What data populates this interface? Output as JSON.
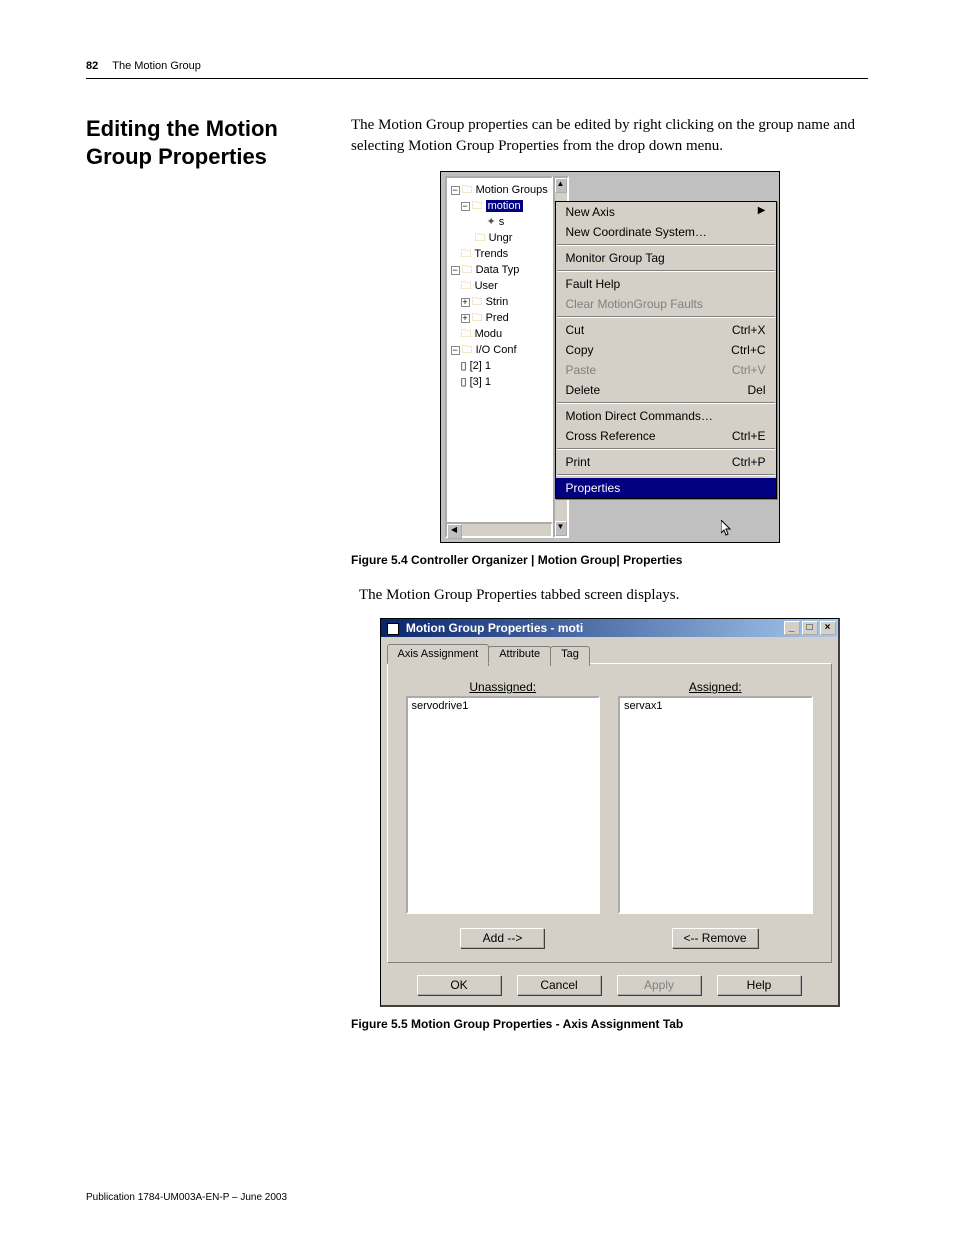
{
  "header": {
    "page_number": "82",
    "chapter": "The Motion Group"
  },
  "section_title": "Editing the Motion Group Properties",
  "intro_text": "The Motion Group properties can be edited by right clicking on the group name and selecting Motion Group Properties from the drop down menu.",
  "tree": {
    "nodes": [
      "Motion Groups",
      "motion",
      "s",
      "Ungr",
      "Trends",
      "Data Typ",
      "User",
      "Strin",
      "Pred",
      "Modu",
      "I/O Conf",
      "[2] 1",
      "[3] 1"
    ]
  },
  "context_menu": {
    "items": [
      {
        "label": "New Axis",
        "shortcut": "",
        "submenu": true
      },
      {
        "label": "New Coordinate System…",
        "shortcut": ""
      },
      {
        "sep": true
      },
      {
        "label": "Monitor Group Tag",
        "shortcut": ""
      },
      {
        "sep": true
      },
      {
        "label": "Fault Help",
        "shortcut": ""
      },
      {
        "label": "Clear MotionGroup Faults",
        "shortcut": "",
        "disabled": true
      },
      {
        "sep": true
      },
      {
        "label": "Cut",
        "shortcut": "Ctrl+X"
      },
      {
        "label": "Copy",
        "shortcut": "Ctrl+C"
      },
      {
        "label": "Paste",
        "shortcut": "Ctrl+V",
        "disabled": true
      },
      {
        "label": "Delete",
        "shortcut": "Del"
      },
      {
        "sep": true
      },
      {
        "label": "Motion Direct Commands…",
        "shortcut": ""
      },
      {
        "label": "Cross Reference",
        "shortcut": "Ctrl+E"
      },
      {
        "sep": true
      },
      {
        "label": "Print",
        "shortcut": "Ctrl+P"
      },
      {
        "sep": true
      },
      {
        "label": "Properties",
        "shortcut": "",
        "highlight": true
      }
    ]
  },
  "figure1_caption": "Figure 5.4 Controller Organizer | Motion Group| Properties",
  "mid_text": "The Motion Group Properties tabbed screen displays.",
  "dialog": {
    "title": "Motion Group Properties - moti",
    "tabs": [
      {
        "label": "Axis Assignment",
        "active": true
      },
      {
        "label": "Attribute",
        "active": false
      },
      {
        "label": "Tag",
        "active": false
      }
    ],
    "unassigned_label": "Unassigned:",
    "assigned_label": "Assigned:",
    "unassigned_items": [
      "servodrive1"
    ],
    "assigned_items": [
      "servax1"
    ],
    "add_button": "Add -->",
    "remove_button": "<-- Remove",
    "ok": "OK",
    "cancel": "Cancel",
    "apply": "Apply",
    "help": "Help"
  },
  "figure2_caption": "Figure 5.5 Motion Group Properties - Axis Assignment Tab",
  "footer": "Publication 1784-UM003A-EN-P – June 2003"
}
